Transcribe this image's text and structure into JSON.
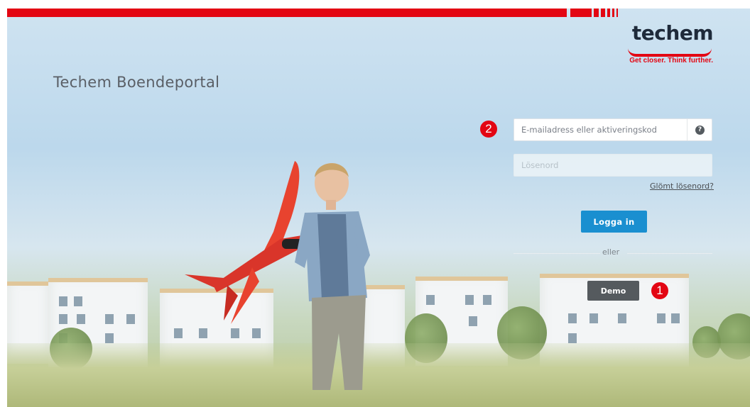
{
  "brand": {
    "logo_text": "techem",
    "tagline": "Get closer. Think further.",
    "accent_color": "#e30613"
  },
  "page_title": "Techem Boendeportal",
  "login": {
    "email_placeholder": "E-mailadress eller aktiveringskod",
    "help_icon": "?",
    "password_placeholder": "Lösenord",
    "forgot_label": "Glömt lösenord?",
    "login_label": "Logga in",
    "login_color": "#1a8fd0",
    "divider_label": "eller",
    "demo_label": "Demo"
  },
  "annotations": {
    "marker_1": "1",
    "marker_2": "2"
  }
}
